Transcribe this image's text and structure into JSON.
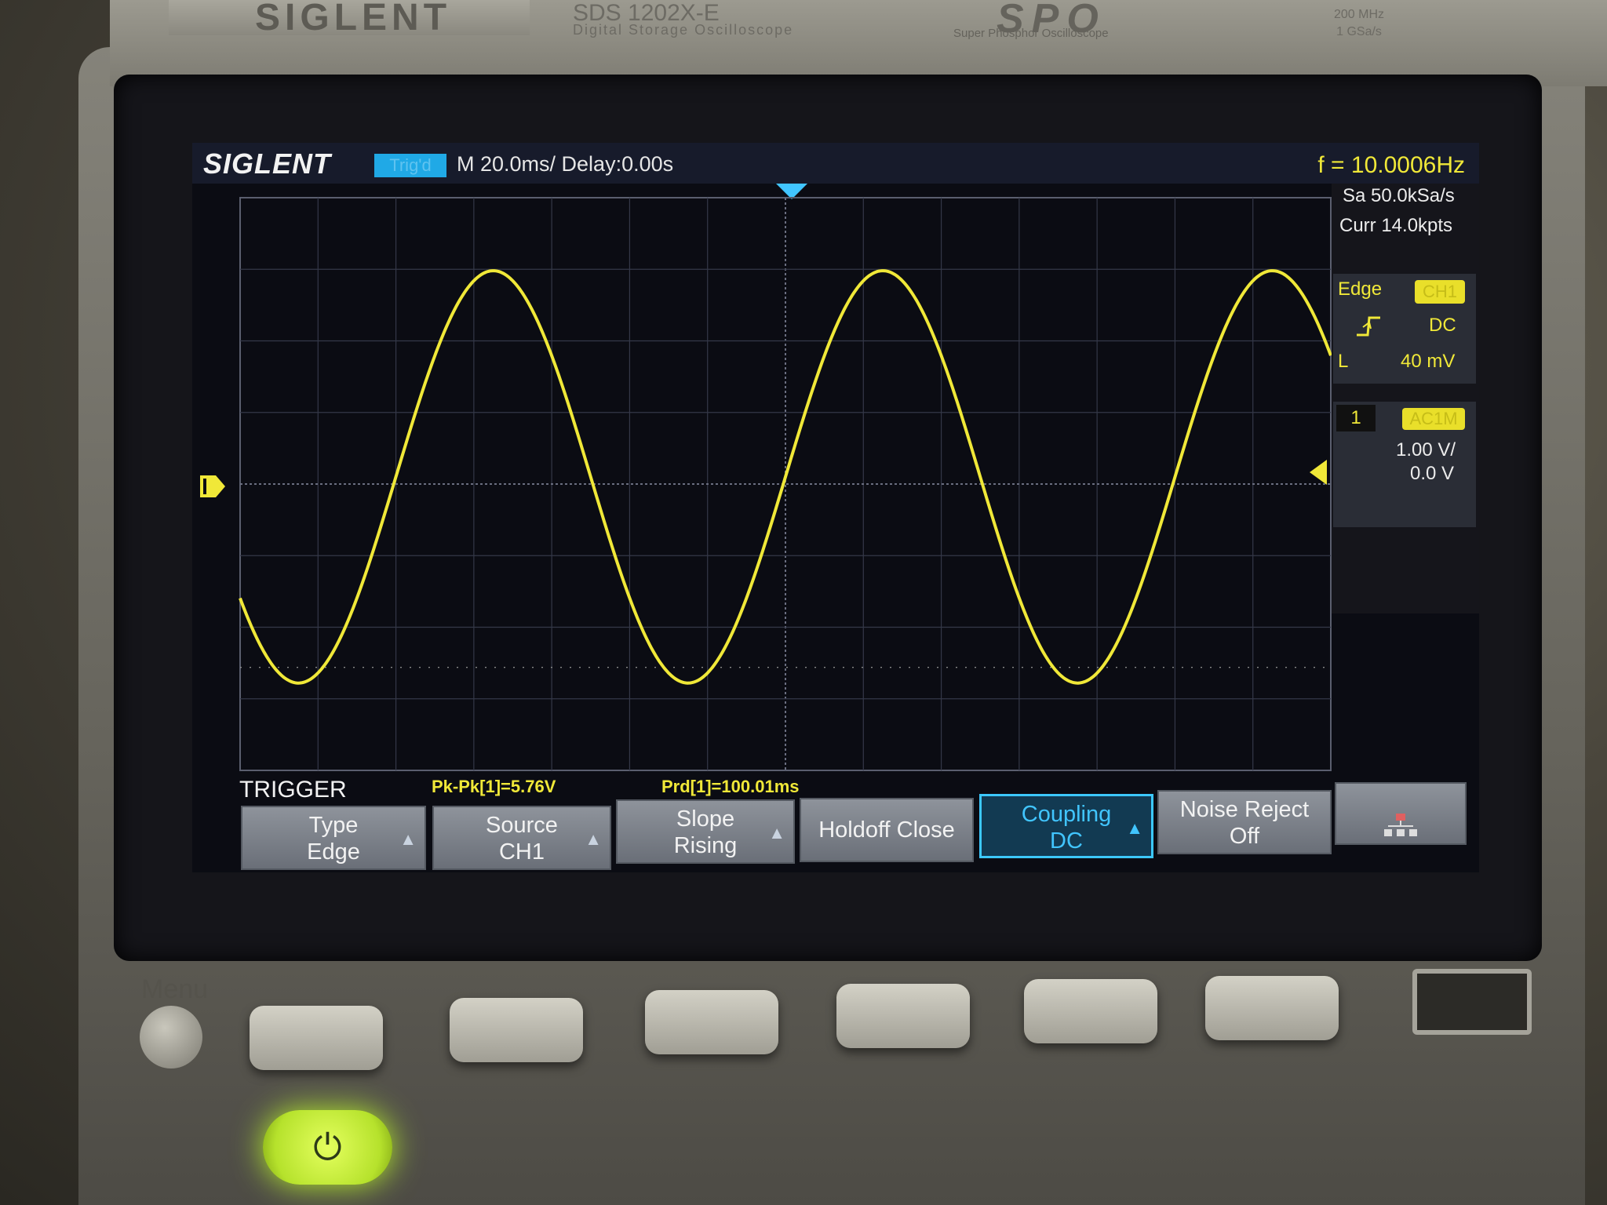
{
  "device": {
    "brand": "SIGLENT",
    "model": "SDS 1202X-E",
    "model_sub": "Digital Storage Oscilloscope",
    "spo": "SPO",
    "spo_sub": "Super Phosphor Oscilloscope",
    "spec_line1": "200 MHz",
    "spec_line2": "1 GSa/s",
    "menu_label": "Menu"
  },
  "topbar": {
    "logo": "SIGLENT",
    "trigger_status": "Trig'd",
    "timebase": "M 20.0ms/ Delay:0.00s",
    "frequency": "f = 10.0006Hz"
  },
  "acquisition": {
    "sample_rate": "Sa 50.0kSa/s",
    "memory": "Curr 14.0kpts"
  },
  "trigger_info": {
    "type": "Edge",
    "source_badge": "CH1",
    "coupling": "DC",
    "level_label": "L",
    "level_value": "40 mV"
  },
  "channel": {
    "number": "1",
    "badge": "AC1M",
    "volts_div": "1.00 V/",
    "offset": "0.0 V"
  },
  "measurements": {
    "pkpk": "Pk-Pk[1]=5.76V",
    "period": "Prd[1]=100.01ms"
  },
  "menu": {
    "title": "TRIGGER",
    "keys": [
      {
        "line1": "Type",
        "line2": "Edge"
      },
      {
        "line1": "Source",
        "line2": "CH1"
      },
      {
        "line1": "Slope",
        "line2": "Rising"
      },
      {
        "line1": "Holdoff Close",
        "line2": ""
      },
      {
        "line1": "Coupling",
        "line2": "DC"
      },
      {
        "line1": "Noise Reject",
        "line2": "Off"
      }
    ]
  },
  "colors": {
    "trace": "#f0e838",
    "accent": "#3cc8ff",
    "power": "#c6f03a"
  },
  "waveform": {
    "frequency_hz": 10.0006,
    "period_ms": 100.01,
    "peak_to_peak_v": 5.76,
    "volts_per_div": 1.0,
    "time_per_div_ms": 20.0
  }
}
